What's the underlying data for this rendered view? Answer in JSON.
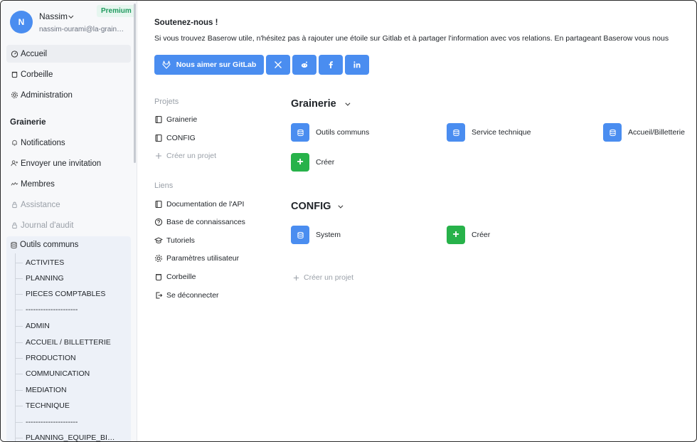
{
  "user": {
    "initial": "N",
    "name": "Nassim",
    "email": "nassim-ourami@la-grain…",
    "badge": "Premium"
  },
  "sidebar": {
    "items": [
      {
        "label": "Accueil",
        "icon": "dashboard-icon"
      },
      {
        "label": "Corbeille",
        "icon": "trash-icon"
      },
      {
        "label": "Administration",
        "icon": "gear-icon"
      }
    ],
    "workspace_title": "Grainerie",
    "ws_items": [
      {
        "label": "Notifications",
        "icon": "bell-icon"
      },
      {
        "label": "Envoyer une invitation",
        "icon": "user-plus-icon"
      },
      {
        "label": "Membres",
        "icon": "members-icon"
      },
      {
        "label": "Assistance",
        "icon": "lock-icon"
      },
      {
        "label": "Journal d'audit",
        "icon": "lock-icon"
      }
    ],
    "database": {
      "name": "Outils communs",
      "tables": [
        "ACTIVITES",
        "PLANNING",
        "PIECES COMPTABLES",
        "---------------------",
        "ADMIN",
        "ACCUEIL / BILLETTERIE",
        "PRODUCTION",
        "COMMUNICATION",
        "MEDIATION",
        "TECHNIQUE",
        "---------------------",
        "PLANNING_EQUIPE_BI…"
      ]
    }
  },
  "support": {
    "title": "Soutenez-nous !",
    "text": "Si vous trouvez Baserow utile, n'hésitez pas à rajouter une étoile sur Gitlab et à partager l'information avec vos relations. En partageant Baserow vous nous",
    "gitlab_label": "Nous aimer sur GitLab"
  },
  "projects": {
    "title": "Projets",
    "items": [
      "Grainerie",
      "CONFIG"
    ],
    "create_label": "Créer un projet"
  },
  "links": {
    "title": "Liens",
    "items": [
      "Documentation de l'API",
      "Base de connaissances",
      "Tutoriels",
      "Paramètres utilisateur",
      "Corbeille",
      "Se déconnecter"
    ]
  },
  "workspaces": [
    {
      "name": "Grainerie",
      "apps": [
        "Outils communs",
        "Service technique",
        "Accueil/Billetterie"
      ],
      "create": "Créer"
    },
    {
      "name": "CONFIG",
      "apps": [
        "System"
      ],
      "create": "Créer"
    }
  ],
  "create_project_label": "Créer un projet",
  "colors": {
    "accent": "#4a8df0",
    "green": "#27b24a",
    "premium_bg": "#e6f6ef",
    "premium_text": "#1f9a5e"
  }
}
